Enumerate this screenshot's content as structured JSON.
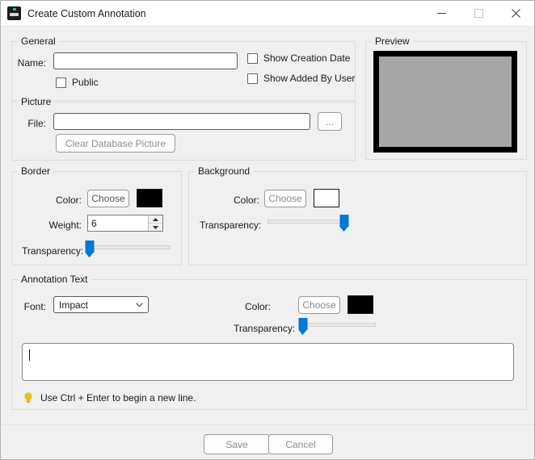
{
  "window": {
    "title": "Create Custom Annotation",
    "icon": "app-icon",
    "controls": {
      "minimize": "minimize-icon",
      "maximize": "maximize-icon",
      "close": "close-icon"
    }
  },
  "general": {
    "legend": "General",
    "name_label": "Name:",
    "name_value": "",
    "public_label": "Public",
    "public_checked": false,
    "show_creation_date_label": "Show Creation Date",
    "show_creation_date_checked": false,
    "show_added_by_user_label": "Show Added By User",
    "show_added_by_user_checked": false
  },
  "picture": {
    "legend": "Picture",
    "file_label": "File:",
    "file_value": "",
    "browse_label": "...",
    "clear_label": "Clear Database Picture"
  },
  "preview": {
    "legend": "Preview",
    "border_color": "#000000",
    "fill_color": "#a6a6a6"
  },
  "border": {
    "legend": "Border",
    "color_label": "Color:",
    "choose_label": "Choose",
    "color_value": "#000000",
    "weight_label": "Weight:",
    "weight_value": "6",
    "transparency_label": "Transparency:",
    "transparency_percent": 0
  },
  "background": {
    "legend": "Background",
    "color_label": "Color:",
    "choose_label": "Choose",
    "color_value": "#ffffff",
    "transparency_label": "Transparency:",
    "transparency_percent": 95
  },
  "annotation_text": {
    "legend": "Annotation Text",
    "font_label": "Font:",
    "font_value": "Impact",
    "color_label": "Color:",
    "choose_label": "Choose",
    "color_value": "#000000",
    "transparency_label": "Transparency:",
    "transparency_percent": 3,
    "text_value": "",
    "hint_icon": "lightbulb-icon",
    "hint_text": "Use Ctrl + Enter to begin a new line."
  },
  "footer": {
    "save_label": "Save",
    "cancel_label": "Cancel"
  }
}
